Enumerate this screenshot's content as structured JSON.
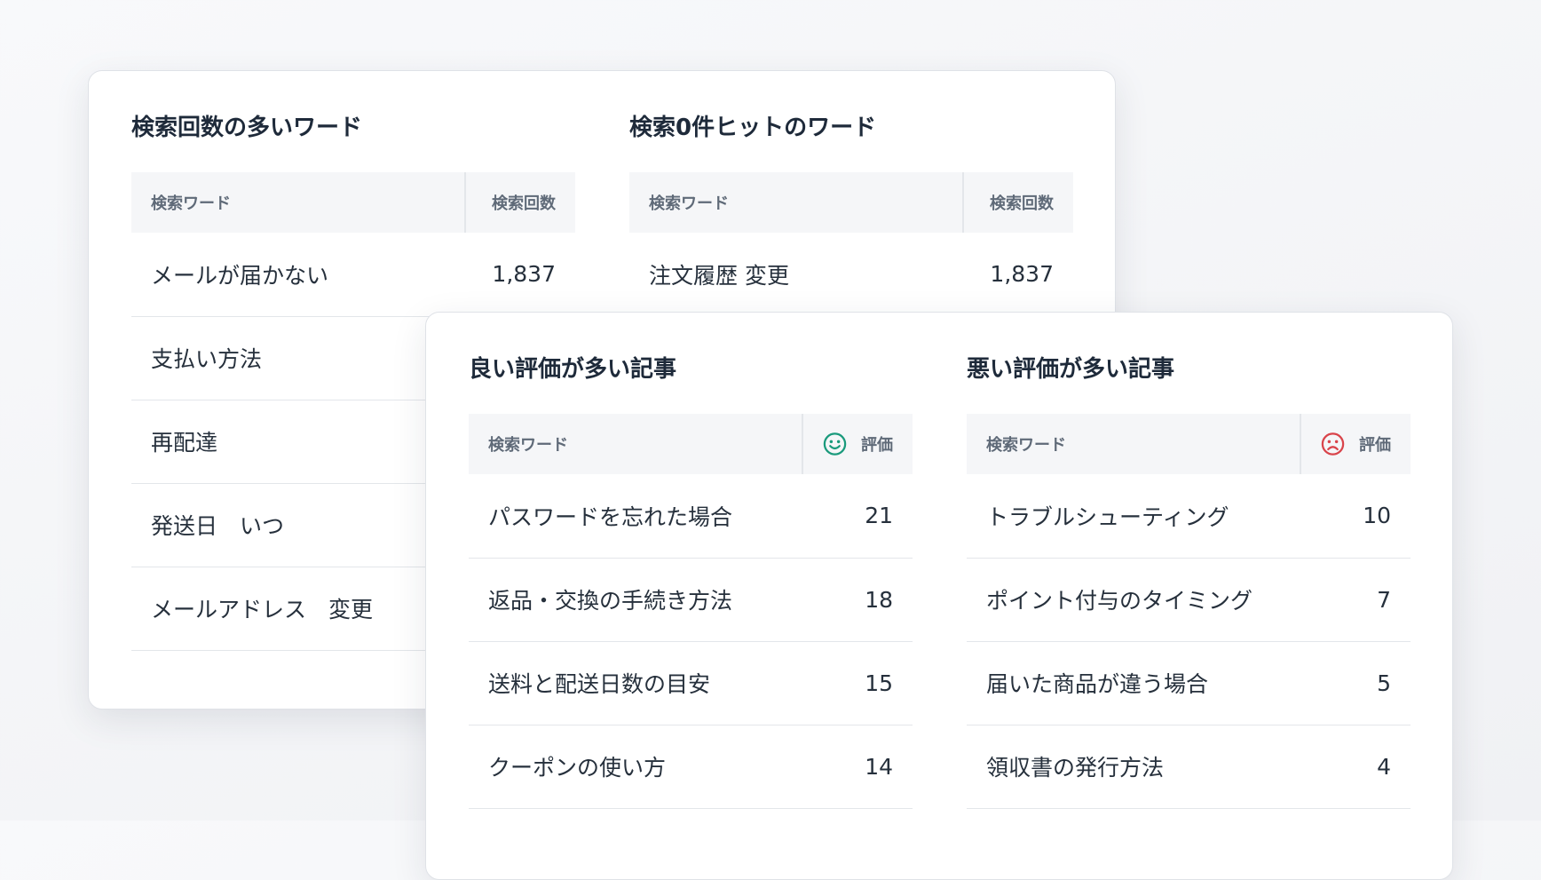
{
  "top_search": {
    "title": "検索回数の多いワード",
    "col_word": "検索ワード",
    "col_count": "検索回数",
    "rows": [
      {
        "word": "メールが届かない",
        "count": "1,837"
      },
      {
        "word": "支払い方法",
        "count": ""
      },
      {
        "word": "再配達",
        "count": ""
      },
      {
        "word": "発送日　いつ",
        "count": ""
      },
      {
        "word": "メールアドレス　変更",
        "count": ""
      }
    ]
  },
  "zero_hit": {
    "title": "検索0件ヒットのワード",
    "col_word": "検索ワード",
    "col_count": "検索回数",
    "rows": [
      {
        "word": "注文履歴 変更",
        "count": "1,837"
      }
    ]
  },
  "good_rated": {
    "title": "良い評価が多い記事",
    "col_word": "検索ワード",
    "col_rating": "評価",
    "icon": "smile-face-icon",
    "accent": "#1a9a7c",
    "rows": [
      {
        "word": "パスワードを忘れた場合",
        "count": "21"
      },
      {
        "word": "返品・交換の手続き方法",
        "count": "18"
      },
      {
        "word": "送料と配送日数の目安",
        "count": "15"
      },
      {
        "word": "クーポンの使い方",
        "count": "14"
      }
    ]
  },
  "bad_rated": {
    "title": "悪い評価が多い記事",
    "col_word": "検索ワード",
    "col_rating": "評価",
    "icon": "sad-face-icon",
    "accent": "#d9444b",
    "rows": [
      {
        "word": "トラブルシューティング",
        "count": "10"
      },
      {
        "word": "ポイント付与のタイミング",
        "count": "7"
      },
      {
        "word": "届いた商品が違う場合",
        "count": "5"
      },
      {
        "word": "領収書の発行方法",
        "count": "4"
      }
    ]
  }
}
